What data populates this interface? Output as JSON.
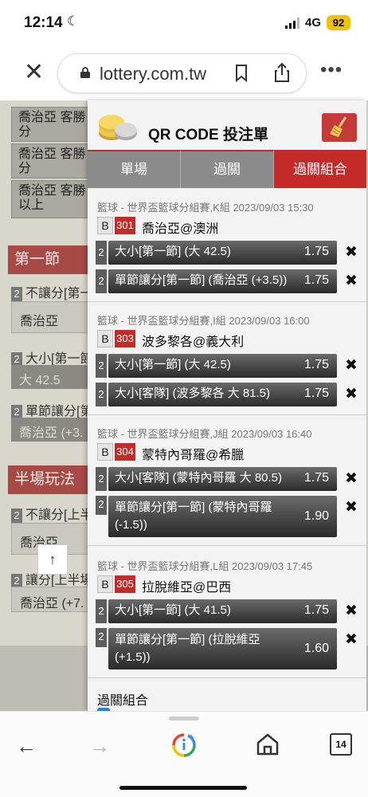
{
  "status": {
    "time": "12:14",
    "network": "4G",
    "battery": "92"
  },
  "browser": {
    "url": "lottery.com.tw",
    "tab_count": "14"
  },
  "background_page": {
    "rows": [
      "喬治亞 客勝 分",
      "喬治亞 客勝 分",
      "喬治亞 客勝 以上"
    ],
    "section1": "第一節",
    "s1_label1": "不讓分[第一",
    "s1_value1": "喬治亞",
    "s1_label2": "大小[第一節",
    "s1_value2": "大 42.5",
    "s1_label3": "單節讓分[第",
    "s1_value3": "喬治亞 (+3.",
    "section2": "半場玩法",
    "s2_label1": "不讓分[上半",
    "s2_value1": "喬治亞",
    "s2_label2": "讓分[上半場",
    "s2_value2": "喬治亞 (+7.",
    "up_arrow": "↑",
    "idx": [
      "2",
      "2",
      "2",
      "2",
      "2"
    ]
  },
  "panel": {
    "title": "QR CODE 投注單",
    "tabs": [
      "單場",
      "過關",
      "過關組合"
    ],
    "active_tab": 2,
    "groups": [
      {
        "league": "籃球 - 世界盃籃球分組賽,K組 2023/09/03 15:30",
        "badge": "B",
        "num": "301",
        "match": "喬治亞@澳洲",
        "bets": [
          {
            "idx": "2",
            "text": "大小[第一節] (大 42.5)",
            "odds": "1.75"
          },
          {
            "idx": "2",
            "text": "單節讓分[第一節] (喬治亞 (+3.5))",
            "odds": "1.75"
          }
        ]
      },
      {
        "league": "籃球 - 世界盃籃球分組賽,I組 2023/09/03 16:00",
        "badge": "B",
        "num": "303",
        "match": "波多黎各@義大利",
        "bets": [
          {
            "idx": "2",
            "text": "大小[第一節] (大 42.5)",
            "odds": "1.75"
          },
          {
            "idx": "2",
            "text": "大小[客隊] (波多黎各 大 81.5)",
            "odds": "1.75"
          }
        ]
      },
      {
        "league": "籃球 - 世界盃籃球分組賽,J組 2023/09/03 16:40",
        "badge": "B",
        "num": "304",
        "match": "蒙特內哥羅@希臘",
        "bets": [
          {
            "idx": "2",
            "text": "大小[客隊] (蒙特內哥羅 大 80.5)",
            "odds": "1.75"
          },
          {
            "idx": "2",
            "text": "單節讓分[第一節] (蒙特內哥羅 (-1.5))",
            "odds": "1.90"
          }
        ]
      },
      {
        "league": "籃球 - 世界盃籃球分組賽,L組 2023/09/03 17:45",
        "badge": "B",
        "num": "305",
        "match": "拉脫維亞@巴西",
        "bets": [
          {
            "idx": "2",
            "text": "大小[第一節] (大 41.5)",
            "odds": "1.75"
          },
          {
            "idx": "2",
            "text": "單節讓分[第一節] (拉脫維亞 (+1.5))",
            "odds": "1.60"
          }
        ]
      }
    ],
    "remove_icon": "✖",
    "combo_label": "過關組合"
  },
  "nav": {
    "back": "←",
    "forward": "→"
  },
  "colors": {
    "accent_red": "#c42a27",
    "tab_gray": "#8b8b8b"
  }
}
